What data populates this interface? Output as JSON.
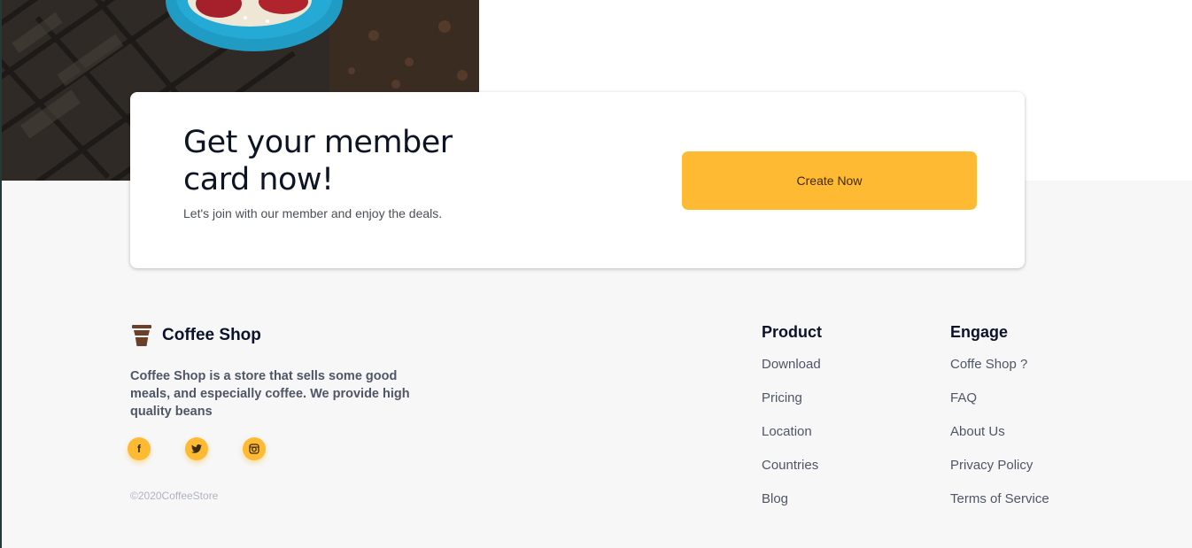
{
  "member_card": {
    "title": "Get your member card now!",
    "subtitle": "Let's join with our member and enjoy the deals.",
    "button_label": "Create Now"
  },
  "brand": {
    "name": "Coffee Shop",
    "description": "Coffee Shop is a store that sells some good meals, and especially coffee. We provide high quality beans",
    "copyright": "©2020CoffeeStore"
  },
  "socials": [
    {
      "icon": "facebook-icon",
      "glyph": "f"
    },
    {
      "icon": "twitter-icon",
      "glyph": "🐦"
    },
    {
      "icon": "instagram-icon",
      "glyph": "◙"
    }
  ],
  "columns": {
    "product": {
      "heading": "Product",
      "links": [
        "Download",
        "Pricing",
        "Location",
        "Countries",
        "Blog"
      ]
    },
    "engage": {
      "heading": "Engage",
      "links": [
        "Coffe Shop ?",
        "FAQ",
        "About Us",
        "Privacy Policy",
        "Terms of Service"
      ]
    }
  },
  "colors": {
    "accent": "#ffba33",
    "heading": "#0b132a",
    "body_text": "#4f5665",
    "footer_bg": "#f7f7f7"
  }
}
